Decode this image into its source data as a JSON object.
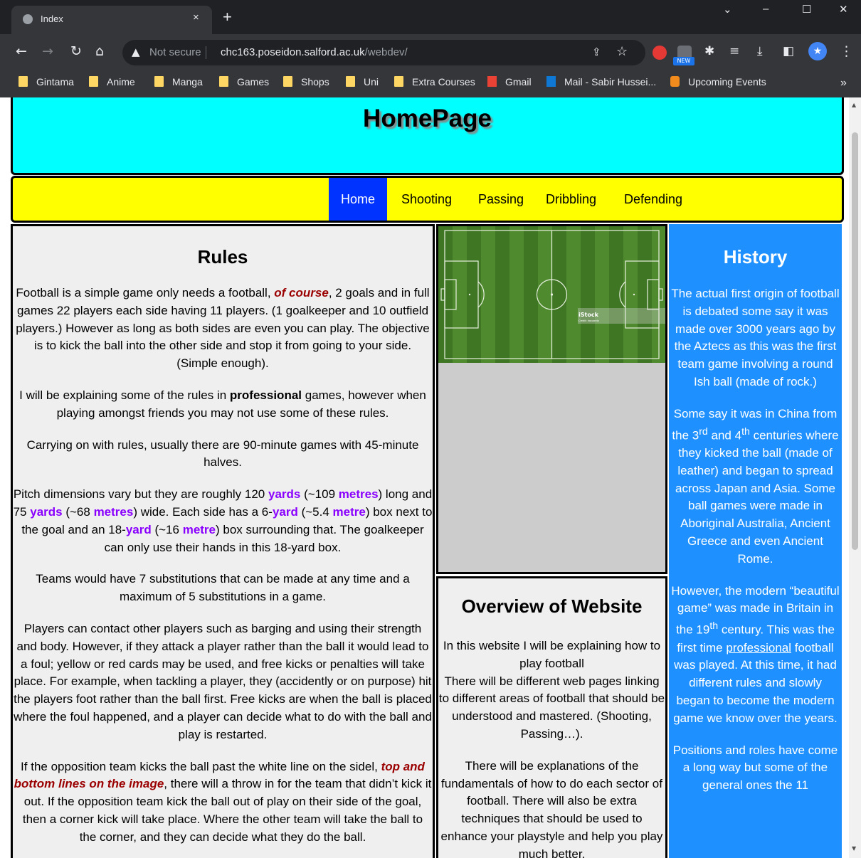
{
  "browser": {
    "tab_title": "Index",
    "tab_close": "×",
    "new_tab": "+",
    "omnibox": {
      "warning": "Not secure",
      "host": "chc163.poseidon.salford.ac.uk",
      "path": "/webdev/"
    },
    "ext_badge": "NEW",
    "bookmarks": [
      {
        "label": "Gintama",
        "icon": "folder-icon"
      },
      {
        "label": "Anime",
        "icon": "folder-icon"
      },
      {
        "label": "Manga",
        "icon": "folder-icon"
      },
      {
        "label": "Games",
        "icon": "folder-icon"
      },
      {
        "label": "Shops",
        "icon": "folder-icon"
      },
      {
        "label": "Uni",
        "icon": "folder-icon"
      },
      {
        "label": "Extra Courses",
        "icon": "folder-icon"
      },
      {
        "label": "Gmail",
        "icon": "gmail-icon"
      },
      {
        "label": "Mail - Sabir Hussei...",
        "icon": "outlook-icon"
      },
      {
        "label": "Upcoming Events",
        "icon": "calendar-icon"
      }
    ],
    "bookmarks_more": "»"
  },
  "site": {
    "title": "HomePage",
    "nav": [
      "Home",
      "Shooting",
      "Passing",
      "Dribbling",
      "Defending"
    ],
    "active_nav": "Home"
  },
  "rules": {
    "heading": "Rules",
    "p1": {
      "a": "Football is a simple game only needs a football, ",
      "b": "of course",
      "c": ", 2 goals and in full games 22 players each side having 11 players. (1 goalkeeper and 10 outfield players.) However as long as both sides are even you can play. The objective is to kick the ball into the other side and stop it from going to your side. (Simple enough)."
    },
    "p2": {
      "a": "I will be explaining some of the rules in ",
      "b": "professional",
      "c": " games, however when playing amongst friends you may not use some of these rules."
    },
    "p3": "Carrying on with rules, usually there are 90-minute games with 45-minute halves.",
    "p4": {
      "a": "Pitch dimensions vary but they are roughly 120 ",
      "yards1": "yards",
      "b": " (~109 ",
      "metres1": "metres",
      "c": ") long and 75 ",
      "yards2": "yards",
      "d": " (~68 ",
      "metres2": "metres",
      "e": ") wide. Each side has a 6-",
      "yard1": "yard",
      "f": " (~5.4 ",
      "metre1": "metre",
      "g": ") box next to the goal and an 18-",
      "yard2": "yard",
      "h": " (~16 ",
      "metre2": "metre",
      "i": ") box surrounding that. The goalkeeper can only use their hands in this 18-yard box."
    },
    "p5": "Teams would have 7 substitutions that can be made at any time and a maximum of 5 substitutions in a game.",
    "p6": "Players can contact other players such as barging and using their strength and body. However, if they attack a player rather than the ball it would lead to a foul; yellow or red cards may be used, and free kicks or penalties will take place. For example, when tackling a player, they (accidently or on purpose) hit the players foot rather than the ball first. Free kicks are when the ball is placed where the foul happened, and a player can decide what to do with the ball and play is restarted.",
    "p7": {
      "a": "If the opposition team kicks the ball past the white line on the sidel, ",
      "b": "top and bottom lines on the image",
      "c": ", there will a throw in for the team that didn’t kick it out. If the opposition team kick the ball out of play on their side of the goal, then a corner kick will take place. Where the other team will take the ball to the corner, and they can decide what they do the ball."
    }
  },
  "pitch_image": {
    "watermark": "iStock",
    "credit": "Credit: hocaonty"
  },
  "overview": {
    "heading": "Overview of Website",
    "p1": "In this website I will be explaining how to play football",
    "p1b": "There will be different web pages linking to different areas of football that should be understood and mastered. (Shooting, Passing…).",
    "p2": "There will be explanations of the fundamentals of how to do each sector of football. There will also be extra techniques that should be used to enhance your playstyle and help you play much better."
  },
  "history": {
    "heading": "History",
    "p1": "The actual first origin of football is debated some say it was made over 3000 years ago by the Aztecs as this was the first team game involving a round Ish ball (made of rock.)",
    "p2": {
      "a": "Some say it was in China from the 3",
      "sup1": "rd",
      "b": " and 4",
      "sup2": "th",
      "c": " centuries where they kicked the ball (made of leather) and began to spread across Japan and Asia. Some ball games were made in Aboriginal Australia, Ancient Greece and even Ancient Rome."
    },
    "p3": {
      "a": "However, the modern “beautiful game” was made in Britain in the 19",
      "sup": "th",
      "b": " century. This was the first time ",
      "link": "professional",
      "c": " football was played. At this time, it had different rules and slowly began to become the modern game we know over the years."
    },
    "p4": "Positions and roles have come a long way but some of the general ones the 11"
  },
  "colors": {
    "header_bg": "#00ffff",
    "nav_bg": "#ffff00",
    "nav_active": "#0033ff",
    "history_bg": "#1e90ff",
    "emphasis_red": "#9b0000",
    "unit_purple": "#8a00ff"
  }
}
